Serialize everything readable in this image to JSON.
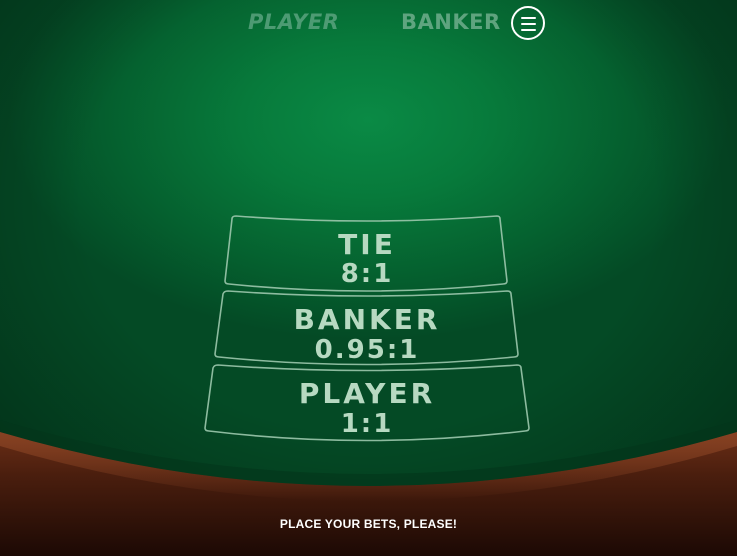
{
  "header": {
    "player_label": "PLAYER",
    "banker_label": "BANKER",
    "menu_icon": "hamburger-menu-icon"
  },
  "bets": {
    "tie": {
      "name": "TIE",
      "odds": "8:1"
    },
    "banker": {
      "name": "BANKER",
      "odds": "0.95:1"
    },
    "player": {
      "name": "PLAYER",
      "odds": "1:1"
    }
  },
  "status": {
    "message": "PLACE YOUR BETS, PLEASE!"
  },
  "colors": {
    "felt": "#077a3b",
    "rail": "#5a2412",
    "bet_text": "#b7d9c1",
    "bet_outline": "#9cc8ad"
  }
}
